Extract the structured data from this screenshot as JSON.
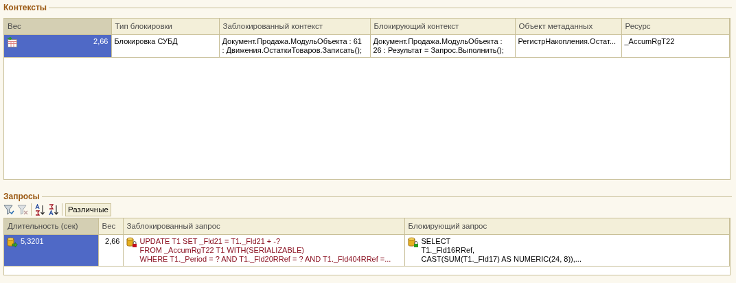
{
  "contexts": {
    "title": "Контексты",
    "columns": [
      "Вес",
      "Тип блокировки",
      "Заблокированный контекст",
      "Блокирующий контекст",
      "Объект метаданных",
      "Ресурс"
    ],
    "rows": [
      {
        "selected": true,
        "cells": [
          "2,66",
          "Блокировка СУБД",
          "Документ.Продажа.МодульОбъекта : 61\n: Движения.ОстаткиТоваров.Записать();",
          "Документ.Продажа.МодульОбъекта :\n26 : Результат = Запрос.Выполнить();",
          "РегистрНакопления.Остат...",
          "_AccumRgT22"
        ]
      }
    ]
  },
  "queries": {
    "title": "Запросы",
    "toolbar": {
      "distinct_button": "Различные"
    },
    "columns": [
      "Длительность (сек)",
      "Вес",
      "Заблокированный запрос",
      "Блокирующий запрос"
    ],
    "rows": [
      {
        "selected": true,
        "cells": [
          "5,3201",
          "2,66",
          "UPDATE T1 SET _Fld21 = T1._Fld21 + -?\nFROM _AccumRgT22 T1 WITH(SERIALIZABLE)\nWHERE T1._Period = ? AND T1._Fld20RRef = ? AND T1._Fld404RRef =...",
          "SELECT\nT1._Fld16RRef,\nCAST(SUM(T1._Fld17) AS NUMERIC(24, 8)),..."
        ]
      }
    ]
  }
}
